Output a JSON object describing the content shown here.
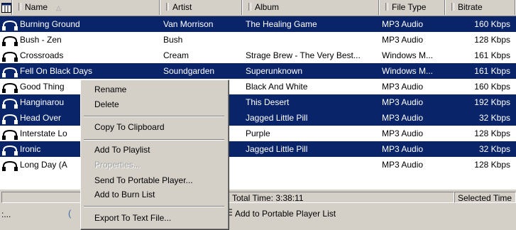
{
  "columns": [
    {
      "label": "Name",
      "sort_glyph": "△"
    },
    {
      "label": "Artist"
    },
    {
      "label": "Album"
    },
    {
      "label": "File Type"
    },
    {
      "label": "Bitrate"
    }
  ],
  "rows": [
    {
      "name": "Burning Ground",
      "artist": "Van Morrison",
      "album": "The Healing Game",
      "type": "MP3 Audio",
      "bitrate": "160 Kbps",
      "selected": true
    },
    {
      "name": "Bush - Zen",
      "artist": "Bush",
      "album": "",
      "type": "MP3 Audio",
      "bitrate": "128 Kbps",
      "selected": false
    },
    {
      "name": "Crossroads",
      "artist": "Cream",
      "album": "Strage Brew - The Very Best...",
      "type": "Windows M...",
      "bitrate": "161 Kbps",
      "selected": false
    },
    {
      "name": "Fell On Black Days",
      "artist": "Soundgarden",
      "album": "Superunknown",
      "type": "Windows M...",
      "bitrate": "161 Kbps",
      "selected": true
    },
    {
      "name": "Good Thing",
      "artist": "",
      "album": "Black And White",
      "type": "MP3 Audio",
      "bitrate": "160 Kbps",
      "selected": false
    },
    {
      "name": "Hanginarou",
      "artist": ":",
      "album": "This Desert",
      "type": "MP3 Audio",
      "bitrate": "192 Kbps",
      "selected": true
    },
    {
      "name": "Head Over",
      "artist": "e",
      "album": "Jagged Little Pill",
      "type": "MP3 Audio",
      "bitrate": "32 Kbps",
      "selected": true
    },
    {
      "name": "Interstate Lo",
      "artist": "P...",
      "album": "Purple",
      "type": "MP3 Audio",
      "bitrate": "128 Kbps",
      "selected": false
    },
    {
      "name": "Ironic",
      "artist": "e",
      "album": "Jagged Little Pill",
      "type": "MP3 Audio",
      "bitrate": "32 Kbps",
      "selected": true
    },
    {
      "name": "Long Day (A",
      "artist": "",
      "album": "",
      "type": "MP3 Audio",
      "bitrate": "128 Kbps",
      "selected": false
    }
  ],
  "status": {
    "total_time": "Total Time: 3:38:11",
    "selected_time": "Selected Time"
  },
  "bottom": {
    "left_text": ":...",
    "add_portable": "Add to Portable Player List"
  },
  "context_menu": {
    "rename": "Rename",
    "delete": "Delete",
    "copy": "Copy To Clipboard",
    "add_playlist": "Add To Playlist",
    "properties": "Properties...",
    "send_portable": "Send To Portable Player...",
    "add_burn": "Add to Burn List",
    "export": "Export To Text File..."
  },
  "colors": {
    "selection": "#0a246a",
    "chrome": "#d4d0c8"
  },
  "icons": {
    "header_corner": "columns-icon",
    "row": "headphones-icon"
  }
}
